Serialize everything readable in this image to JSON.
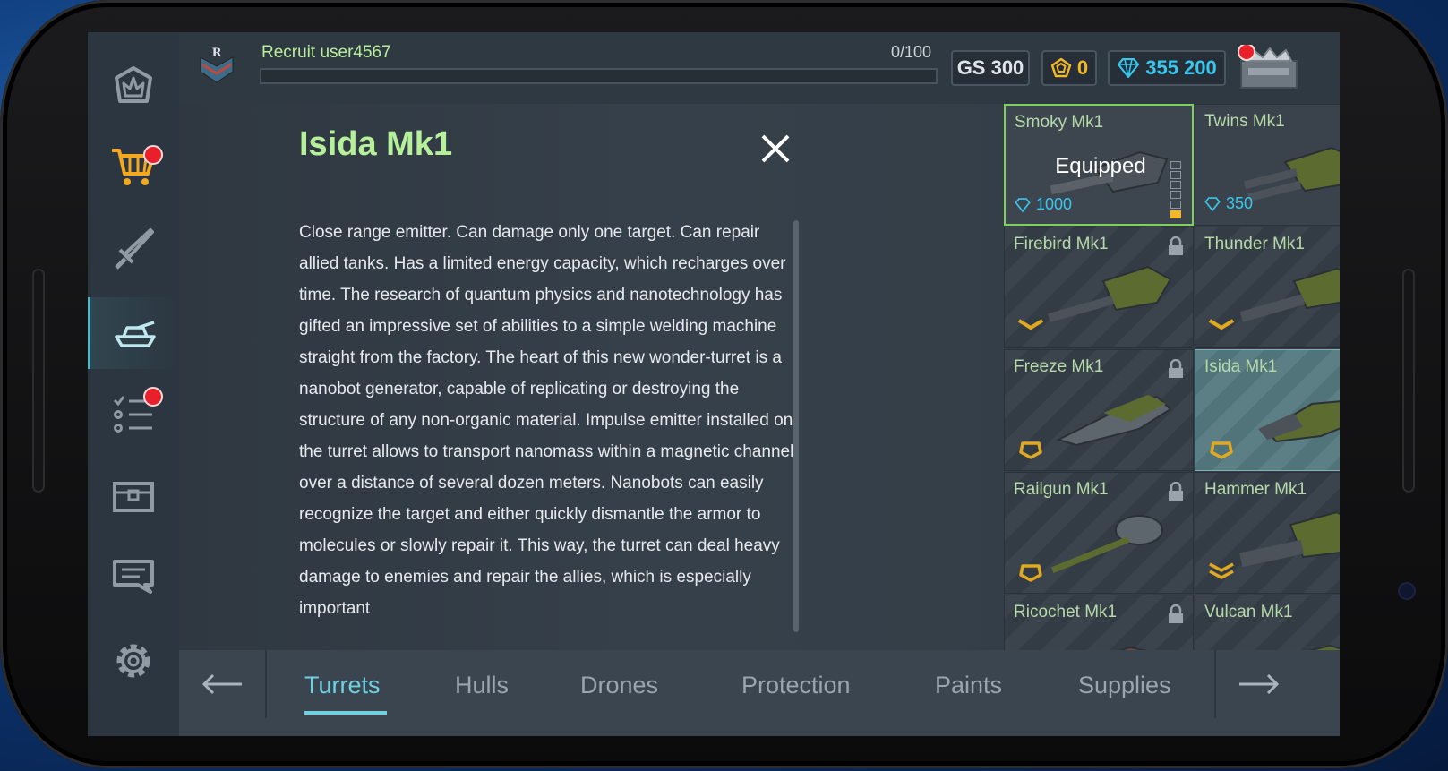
{
  "header": {
    "player_name": "Recruit  user4567",
    "xp_text": "0/100",
    "xp_progress": 0,
    "gs": "GS 300",
    "stars": "0",
    "crystals": "355 200"
  },
  "sidebar": {
    "items": [
      {
        "name": "home",
        "icon": "crown-icon"
      },
      {
        "name": "shop",
        "icon": "cart-icon",
        "badge": true
      },
      {
        "name": "battle",
        "icon": "sword-icon"
      },
      {
        "name": "garage",
        "icon": "tank-icon",
        "active": true
      },
      {
        "name": "missions",
        "icon": "checklist-icon",
        "badge": true
      },
      {
        "name": "containers",
        "icon": "chest-icon"
      },
      {
        "name": "chat",
        "icon": "chat-icon"
      },
      {
        "name": "settings",
        "icon": "gear-icon"
      }
    ]
  },
  "detail": {
    "title": "Isida Mk1",
    "description": "Close range emitter. Can damage only one target. Can repair allied tanks. Has a limited energy capacity, which recharges over time. The research of quantum physics and nanotechnology has gifted an impressive set of abilities to a simple welding machine straight from the factory. The heart of this new wonder-turret is a nanobot generator, capable of replicating or destroying the structure of any non-organic material. Impulse emitter installed on the turret allows to transport nanomass within a magnetic channel over a distance of several dozen meters. Nanobots can easily recognize the target and either quickly dismantle the armor to molecules or slowly repair it. This way, the turret can deal heavy damage to enemies and repair the allies, which is especially important"
  },
  "turrets": [
    {
      "name": "Smoky Mk1",
      "status": "Equipped",
      "price": "1000",
      "locked": false
    },
    {
      "name": "Twins Mk1",
      "price": "350",
      "locked": false
    },
    {
      "name": "Firebird Mk1",
      "locked": true
    },
    {
      "name": "Thunder Mk1",
      "locked": true
    },
    {
      "name": "Freeze Mk1",
      "locked": true
    },
    {
      "name": "Isida Mk1",
      "locked": true,
      "selected": true
    },
    {
      "name": "Railgun Mk1",
      "locked": true
    },
    {
      "name": "Hammer Mk1",
      "locked": true
    },
    {
      "name": "Ricochet Mk1",
      "locked": true
    },
    {
      "name": "Vulcan Mk1",
      "locked": true
    }
  ],
  "tabs": [
    {
      "label": "Turrets",
      "active": true
    },
    {
      "label": "Hulls"
    },
    {
      "label": "Drones"
    },
    {
      "label": "Protection"
    },
    {
      "label": "Paints"
    },
    {
      "label": "Supplies"
    }
  ],
  "colors": {
    "accent": "#6fd0df",
    "title_green": "#b6f09a",
    "crystal_blue": "#38c6ef",
    "star_gold": "#f3b824",
    "badge_red": "#e8202a"
  }
}
